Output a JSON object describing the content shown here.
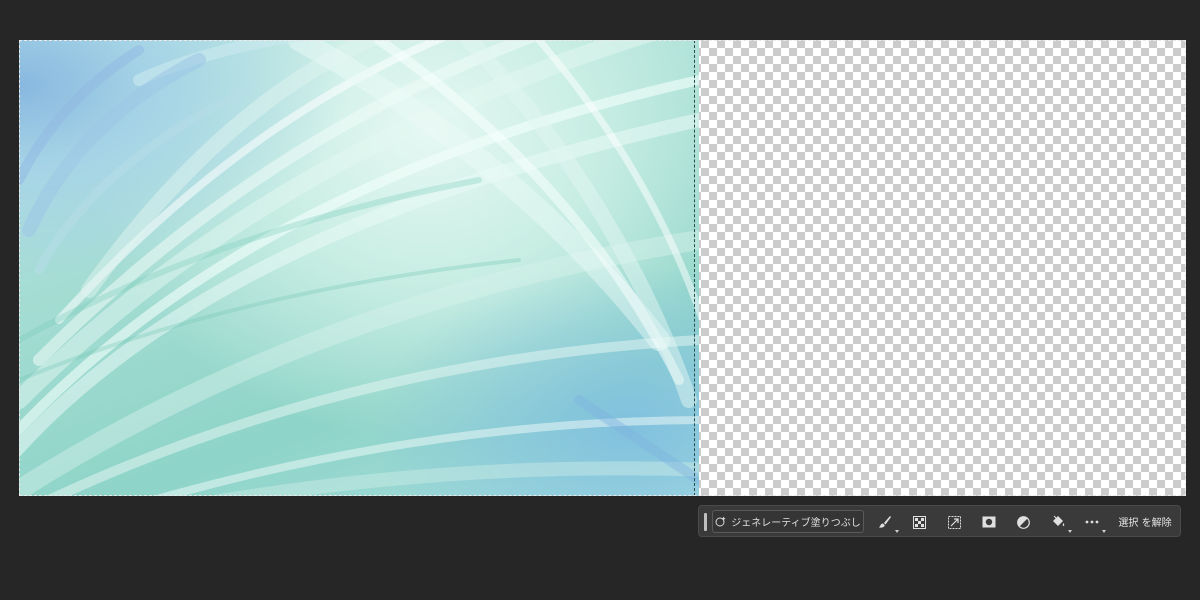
{
  "canvas": {
    "layer_content": "abstract-mint-paint-strokes",
    "transparency_pattern": "checkerboard",
    "selection_style": "marching-ants"
  },
  "taskbar": {
    "generative_fill_label": "ジェネレーティブ塗りつぶし",
    "deselect_label": "選択 を解除",
    "tools": [
      {
        "icon": "brush-modify-icon",
        "has_dropdown": true
      },
      {
        "icon": "select-subject-icon",
        "has_dropdown": false
      },
      {
        "icon": "transform-selection-icon",
        "has_dropdown": false
      },
      {
        "icon": "layer-mask-icon",
        "has_dropdown": false
      },
      {
        "icon": "adjustment-layer-icon",
        "has_dropdown": false
      },
      {
        "icon": "paint-bucket-icon",
        "has_dropdown": true
      },
      {
        "icon": "more-options-icon",
        "has_dropdown": true
      }
    ]
  },
  "colors": {
    "workspace_bg": "#262626",
    "taskbar_bg": "#3a3a3a",
    "taskbar_text": "#e0e0e0",
    "paint_primary": "#a3dcd2",
    "paint_highlight": "#e6f8f3",
    "paint_blue": "#88b8e0"
  }
}
